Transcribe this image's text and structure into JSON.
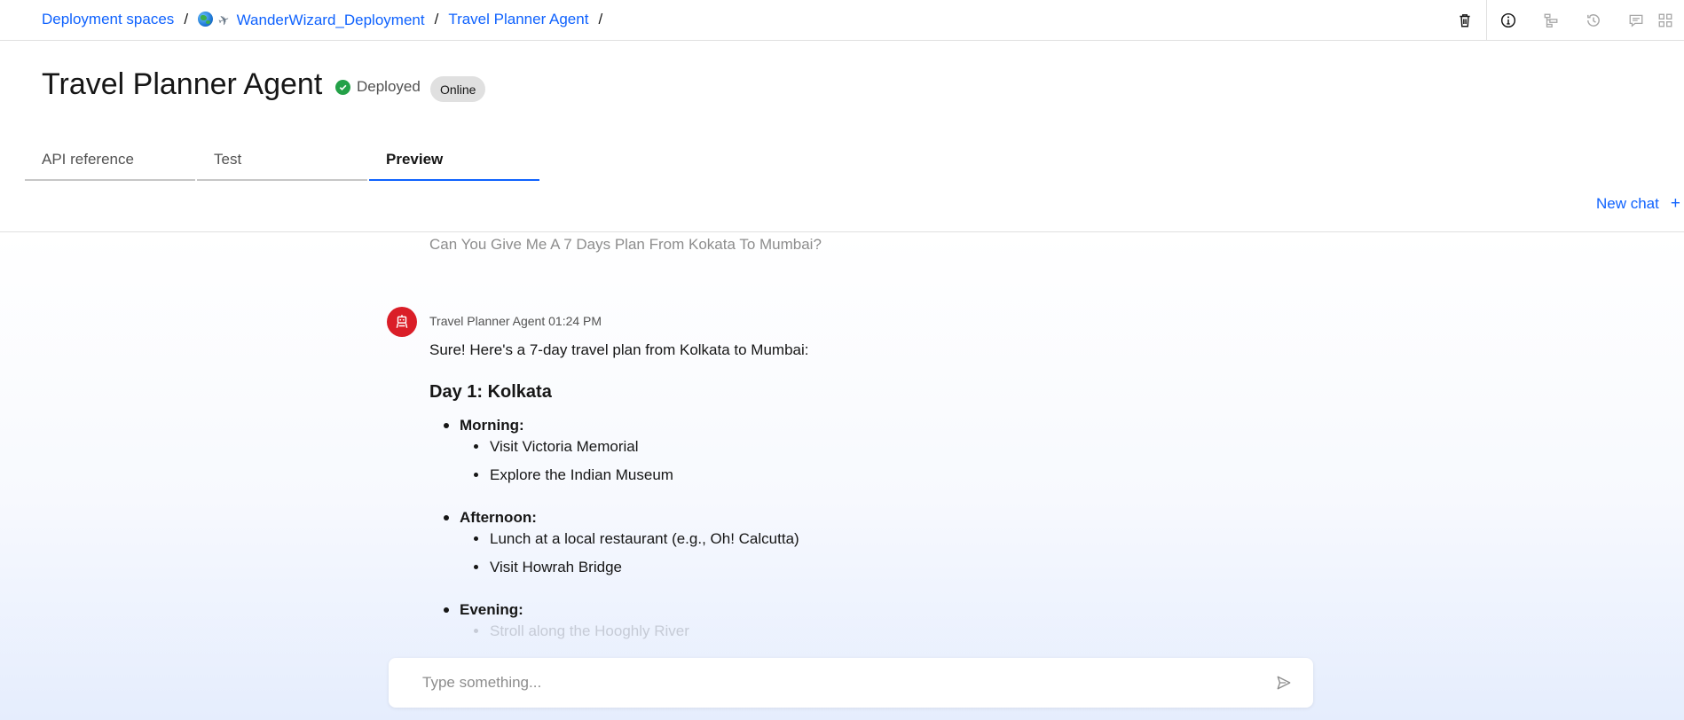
{
  "breadcrumb": {
    "items": [
      {
        "label": "Deployment spaces"
      },
      {
        "label": "WanderWizard_Deployment",
        "icons": [
          "globe-icon",
          "airplane-icon"
        ]
      },
      {
        "label": "Travel Planner Agent"
      }
    ],
    "separator": "/"
  },
  "toolbar": {
    "icons": [
      "trash-icon",
      "info-icon",
      "flow-icon",
      "history-icon",
      "chat-icon",
      "grid-icon"
    ]
  },
  "header": {
    "title": "Travel Planner Agent",
    "status": "Deployed",
    "badge": "Online"
  },
  "tabs": [
    {
      "label": "API reference",
      "active": false
    },
    {
      "label": "Test",
      "active": false
    },
    {
      "label": "Preview",
      "active": true
    }
  ],
  "chat": {
    "new_chat_label": "New chat",
    "user_message": "Can You Give Me A 7 Days Plan From Kokata To Mumbai?",
    "agent": {
      "name": "Travel Planner Agent",
      "time": "01:24 PM"
    },
    "response": {
      "intro": "Sure! Here's a 7-day travel plan from Kolkata to Mumbai:",
      "day_heading": "Day 1: Kolkata",
      "periods": [
        {
          "label": "Morning:",
          "items": [
            "Visit Victoria Memorial",
            "Explore the Indian Museum"
          ]
        },
        {
          "label": "Afternoon:",
          "items": [
            "Lunch at a local restaurant (e.g., Oh! Calcutta)",
            "Visit Howrah Bridge"
          ]
        },
        {
          "label": "Evening:",
          "items": [
            "Stroll along the Hooghly River"
          ]
        }
      ]
    },
    "input_placeholder": "Type something...",
    "accent_color": "#0f62fe",
    "avatar_color": "#da1e28"
  }
}
